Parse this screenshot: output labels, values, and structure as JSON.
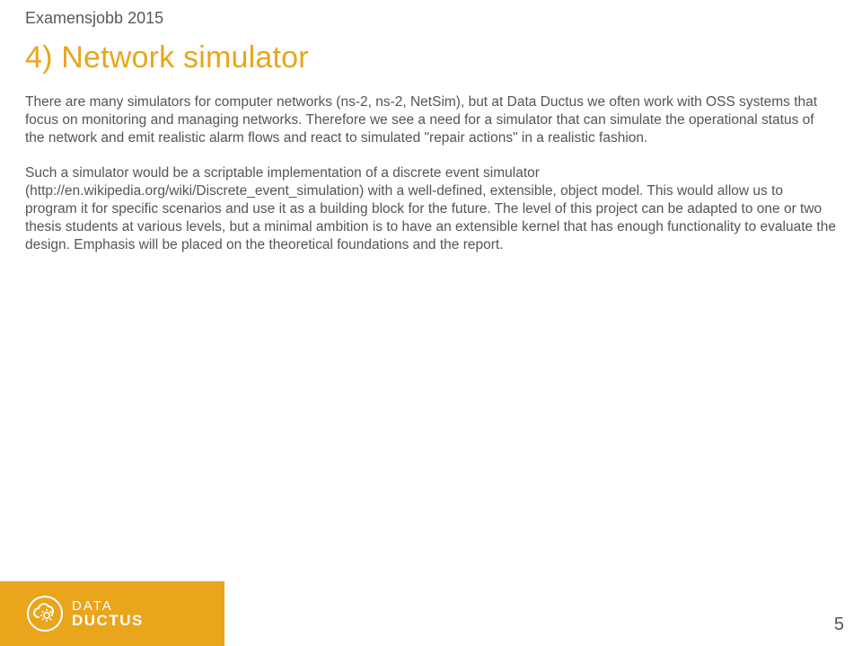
{
  "header": {
    "label": "Examensjobb 2015"
  },
  "title": "4) Network simulator",
  "paragraphs": [
    "There are many simulators for computer networks (ns-2, ns-2, NetSim), but at Data Ductus we often work with OSS systems that focus on monitoring and managing networks. Therefore we see a need for a simulator that can simulate the operational status of the network and emit realistic alarm flows and react to simulated \"repair actions\" in a realistic fashion.",
    "Such a simulator would be a scriptable implementation of a discrete event simulator (http://en.wikipedia.org/wiki/Discrete_event_simulation) with a well-defined, extensible, object model. This would allow us to program it for specific scenarios and use it as a building block for the future. The level of this project can be adapted to one or two thesis students at various levels, but a minimal ambition is to have an extensible kernel that has enough functionality to evaluate the design. Emphasis will be placed on the theoretical foundations and the report."
  ],
  "footer": {
    "logo": {
      "line1": "DATA",
      "line2": "DUCTUS"
    },
    "page_number": "5"
  },
  "colors": {
    "accent": "#e9a51b"
  }
}
